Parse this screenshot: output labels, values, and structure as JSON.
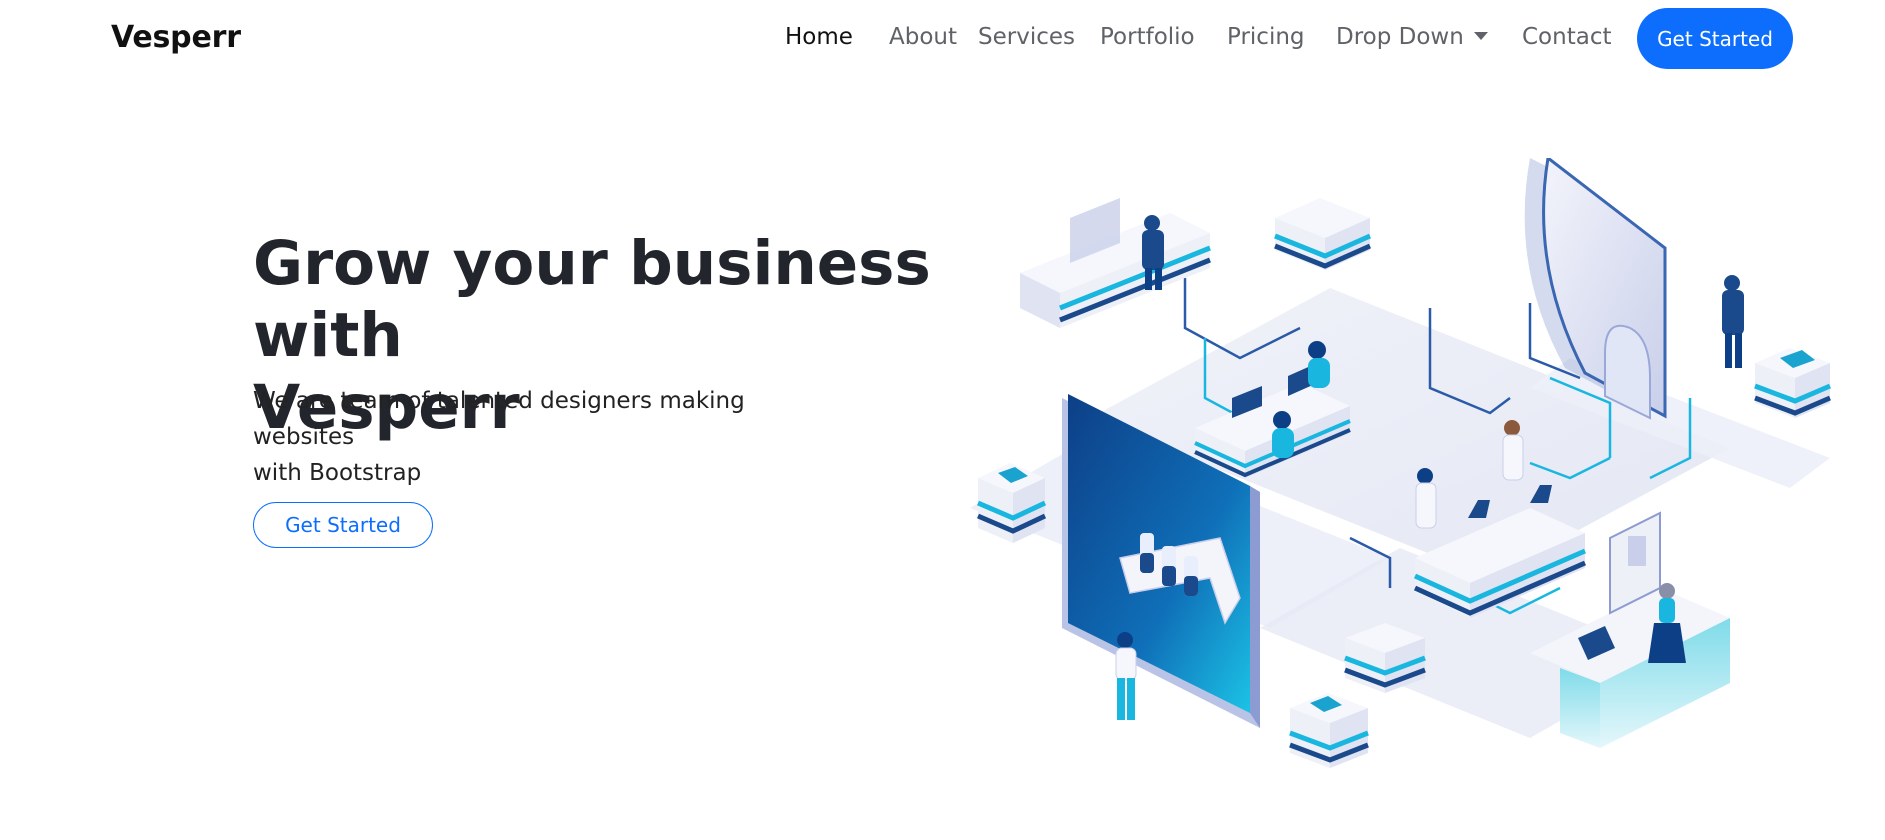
{
  "header": {
    "logo": "Vesperr",
    "nav": [
      {
        "label": "Home"
      },
      {
        "label": "About"
      },
      {
        "label": "Services"
      },
      {
        "label": "Portfolio"
      },
      {
        "label": "Pricing"
      },
      {
        "label": "Drop Down"
      },
      {
        "label": "Contact"
      }
    ],
    "cta_label": "Get Started"
  },
  "hero": {
    "title_line1": "Grow your business with",
    "title_line2": "Vesperr",
    "subtitle_line1": "We are team of talented designers making websites",
    "subtitle_line2": "with Bootstrap",
    "button_label": "Get Started"
  },
  "colors": {
    "accent": "#0d6efd",
    "nav_text": "#5f6368",
    "active_nav_text": "#111111",
    "illustration_dark_blue": "#1a4a8c",
    "illustration_cyan": "#19b7df"
  },
  "icons": {
    "dropdown_caret": "caret-down-icon",
    "hero_image": "isometric-team-workspace-illustration"
  }
}
